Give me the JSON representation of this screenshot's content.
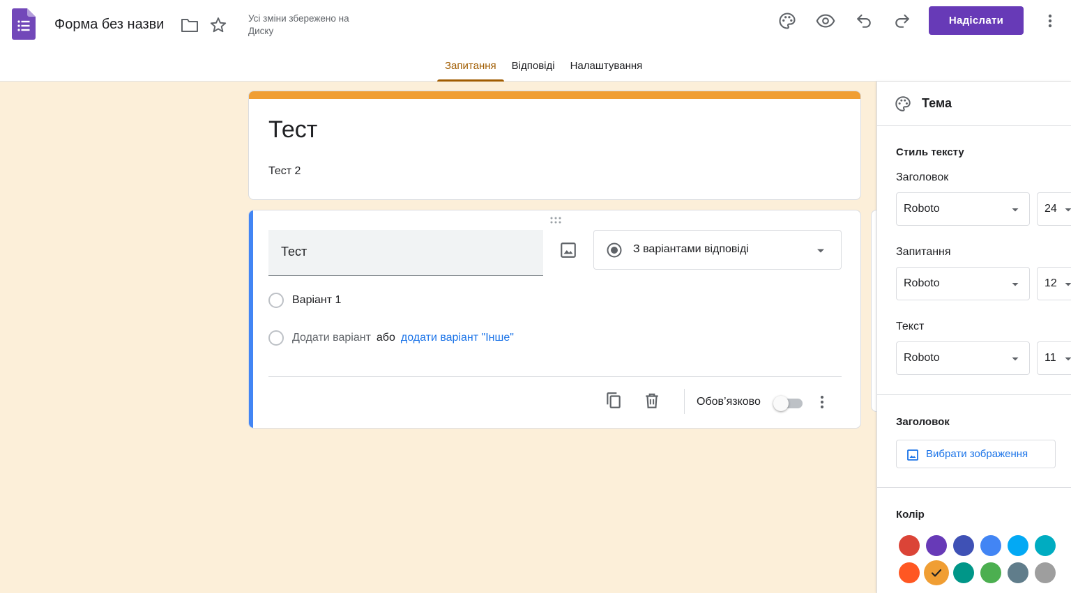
{
  "header": {
    "doc_title": "Форма без назви",
    "save_status": "Усі зміни збережено на Диску",
    "send_label": "Надіслати"
  },
  "tabs": [
    {
      "label": "Запитання",
      "active": true
    },
    {
      "label": "Відповіді",
      "active": false
    },
    {
      "label": "Налаштування",
      "active": false
    }
  ],
  "form": {
    "title": "Тест",
    "description": "Тест 2"
  },
  "question": {
    "title": "Тест",
    "type_label": "З варіантами відповіді",
    "option1": "Варіант 1",
    "add_option": "Додати варіант",
    "or_text": "або",
    "add_other": "додати варіант \"Інше\"",
    "required_label": "Обов’язково",
    "required": false
  },
  "theme_panel": {
    "title": "Тема",
    "text_style_title": "Стиль тексту",
    "header_label": "Заголовок",
    "header_font": "Roboto",
    "header_size": "24",
    "question_label": "Запитання",
    "question_font": "Roboto",
    "question_size": "12",
    "text_label": "Текст",
    "text_font": "Roboto",
    "text_size": "11",
    "header_section_title": "Заголовок",
    "choose_image_label": "Вибрати зображення",
    "color_title": "Колір",
    "colors_row1": [
      "#db4437",
      "#673ab7",
      "#3f51b5",
      "#4285f4",
      "#03a9f4",
      "#00acc1"
    ],
    "colors_row2": [
      "#ff5722",
      "#f09e33",
      "#009688",
      "#4caf50",
      "#607d8b",
      "#9e9e9e"
    ],
    "selected_color": "#f09e33"
  },
  "colors": {
    "accent": "#673ab7",
    "tab_active": "#a05c00",
    "theme_band": "#f09e33",
    "background": "#fcefd9",
    "question_bar": "#4285f4"
  }
}
